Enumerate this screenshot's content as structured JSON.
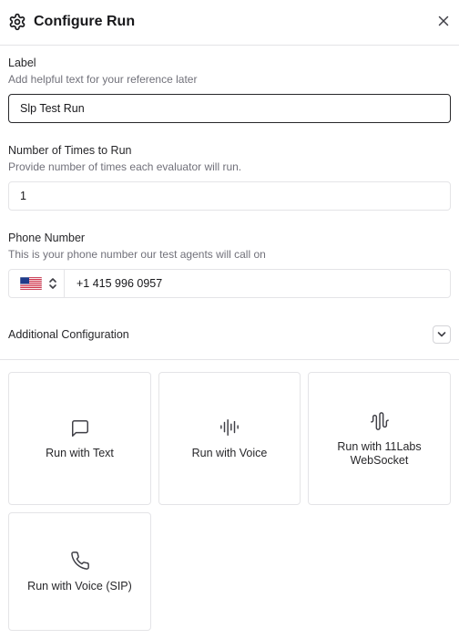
{
  "header": {
    "title": "Configure Run",
    "icon": "gear-icon",
    "close_icon": "close-icon"
  },
  "label_field": {
    "label": "Label",
    "help": "Add helpful text for your reference later",
    "value": "Slp Test Run"
  },
  "runs_field": {
    "label": "Number of Times to Run",
    "help": "Provide number of times each evaluator will run.",
    "value": "1"
  },
  "phone_field": {
    "label": "Phone Number",
    "help": "This is your phone number our test agents will call on",
    "country_flag": "us-flag-icon",
    "value": "+1 415 996 0957"
  },
  "additional": {
    "label": "Additional Configuration",
    "icon": "chevron-down-icon"
  },
  "run_options": [
    {
      "label": "Run with Text",
      "icon": "message-square-icon"
    },
    {
      "label": "Run with Voice",
      "icon": "audio-lines-icon"
    },
    {
      "label": "Run with 11Labs WebSocket",
      "icon": "audio-waveform-icon"
    },
    {
      "label": "Run with Voice (SIP)",
      "icon": "phone-icon"
    }
  ]
}
